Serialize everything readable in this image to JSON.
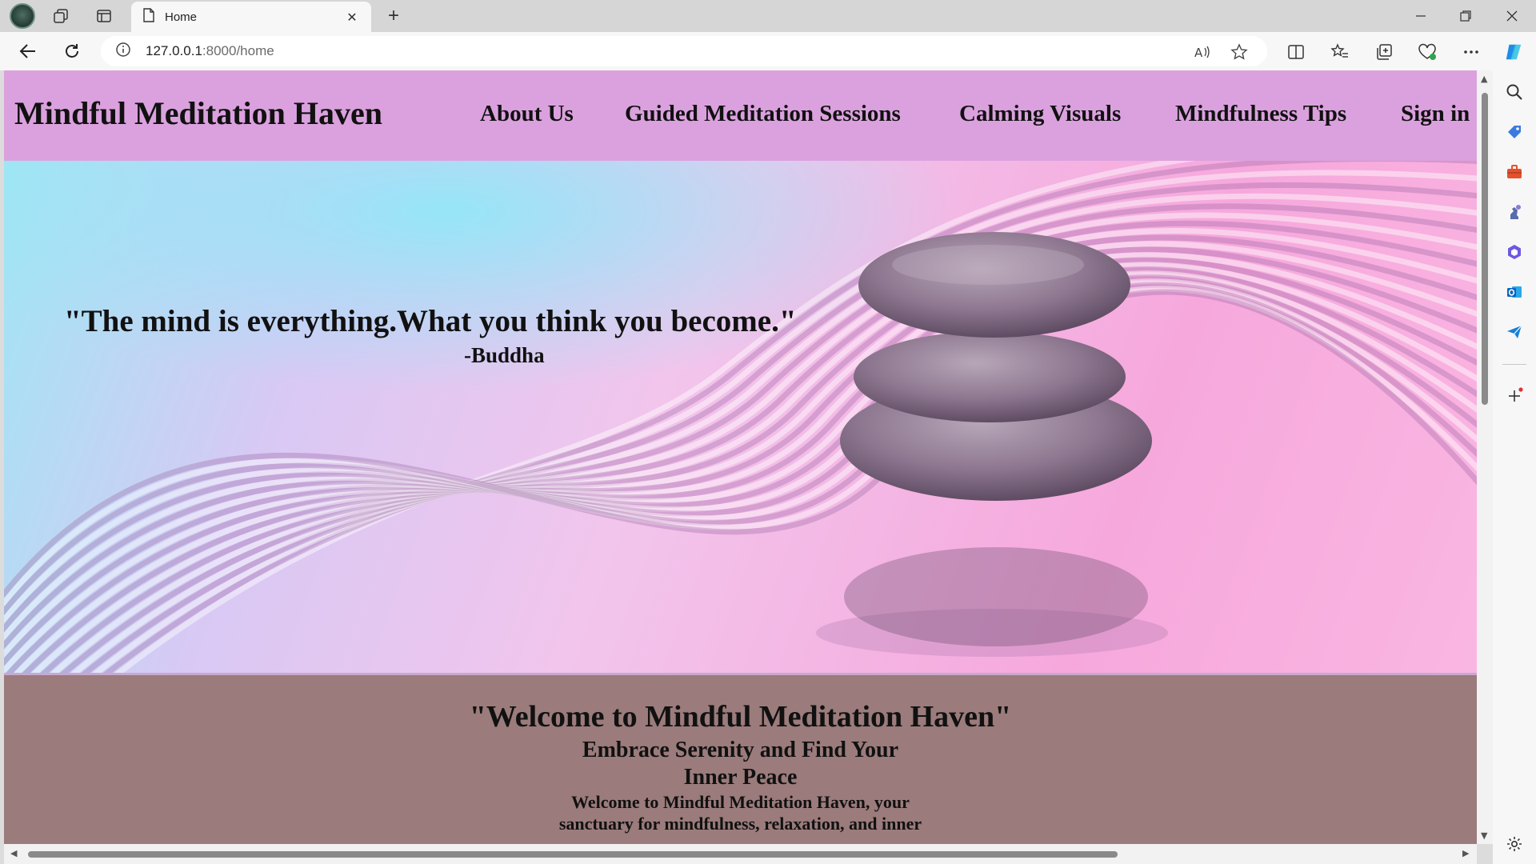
{
  "browser": {
    "tab_title": "Home",
    "url_host": "127.0.0.1",
    "url_rest": ":8000/home",
    "accent": "#dba1de"
  },
  "site": {
    "title": "Mindful Meditation Haven",
    "nav": [
      {
        "label": "About Us"
      },
      {
        "label": "Guided Meditation Sessions"
      },
      {
        "label": "Calming Visuals"
      },
      {
        "label": "Mindfulness Tips"
      },
      {
        "label": "Sign in"
      }
    ]
  },
  "hero": {
    "quote": "\"The mind is everything.What you think you become.\"",
    "author": "-Buddha"
  },
  "welcome": {
    "heading": "\"Welcome to Mindful Meditation Haven\"",
    "subheading_line1": "Embrace Serenity and Find Your",
    "subheading_line2": "Inner Peace",
    "body_line1": "Welcome to Mindful Meditation Haven, your",
    "body_line2": "sanctuary for mindfulness, relaxation, and inner"
  },
  "colors": {
    "header_bg": "#dba1de",
    "welcome_bg": "#9b7b7b"
  }
}
